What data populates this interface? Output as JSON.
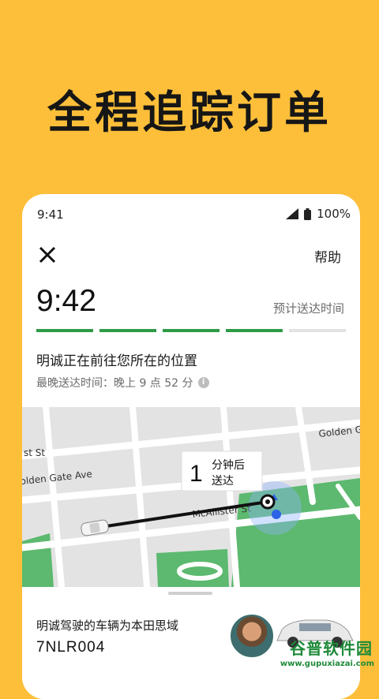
{
  "promo": {
    "headline": "全程追踪订单"
  },
  "status_bar": {
    "time": "9:41",
    "battery": "100%"
  },
  "header": {
    "help_label": "帮助"
  },
  "eta": {
    "time": "9:42",
    "label": "预计送达时间",
    "progress_fraction": 0.8,
    "segments_total": 5,
    "segments_done": 4
  },
  "trip": {
    "status_text": "明诚正在前往您所在的位置",
    "latest_time": "最晚送达时间：晚上 9 点 52 分"
  },
  "map": {
    "minutes": "1",
    "minutes_line1": "分钟后",
    "minutes_line2": "送达",
    "streets": [
      "Golden G",
      "st St",
      "olden Gate Ave",
      "McAllister St"
    ]
  },
  "vehicle": {
    "description": "明诚驾驶的车辆为本田思域",
    "plate": "7NLR004"
  },
  "watermark": {
    "name": "谷普软件园",
    "url": "www.gupuxiazai.com"
  },
  "colors": {
    "background": "#FDBF3A",
    "progress": "#2f9a45",
    "route": "#111111",
    "park": "#58b86d"
  }
}
